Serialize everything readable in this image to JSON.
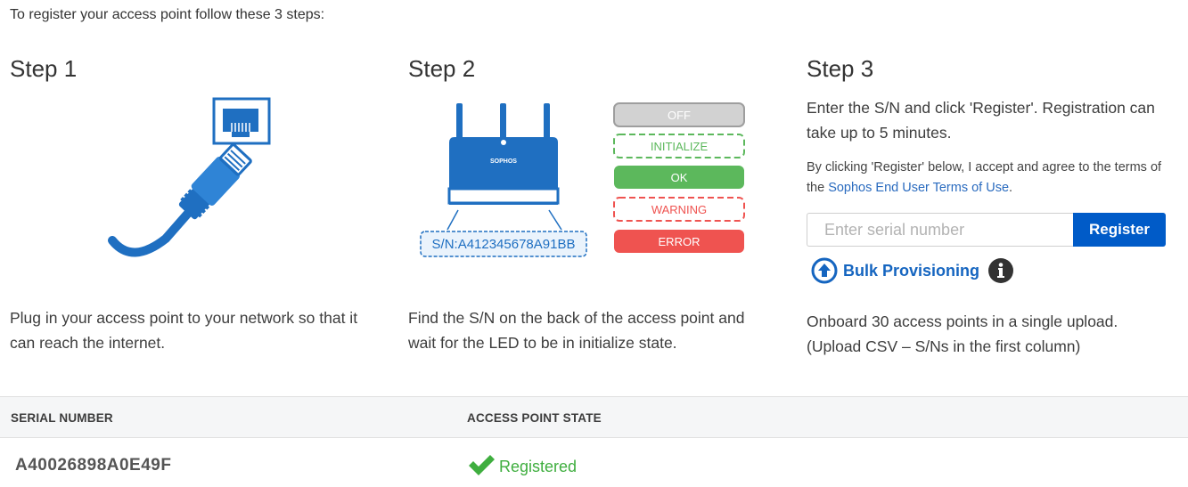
{
  "intro": "To register your access point follow these 3 steps:",
  "step1": {
    "title": "Step 1",
    "description": "Plug in your access point to your network so that it can reach the internet."
  },
  "step2": {
    "title": "Step 2",
    "description": "Find the S/N on the back of the access point and wait for the LED to be in initialize state.",
    "device_brand": "SOPHOS",
    "serial_label": "S/N:A412345678A91BB",
    "led_states": [
      "OFF",
      "INITIALIZE",
      "OK",
      "WARNING",
      "ERROR"
    ]
  },
  "step3": {
    "title": "Step 3",
    "instructions": "Enter the S/N and click 'Register'. Registration can take up to 5 minutes.",
    "terms_prefix": "By clicking 'Register' below, I accept and agree to the terms of the ",
    "terms_link": "Sophos End User Terms of Use",
    "terms_suffix": ".",
    "serial_placeholder": "Enter serial number",
    "serial_value": "",
    "register_label": "Register",
    "bulk_label": "Bulk Provisioning",
    "onboard_text": "Onboard 30 access points in a single upload. (Upload CSV – S/Ns in the first column)"
  },
  "table": {
    "headers": [
      "SERIAL NUMBER",
      "ACCESS POINT STATE"
    ],
    "rows": [
      {
        "serial": "A40026898A0E49F",
        "state": "Registered"
      }
    ]
  },
  "colors": {
    "primary": "#005bc8",
    "link": "#1565c0",
    "success": "#3fae3f",
    "device_blue": "#1f6fc1",
    "led_ok": "#5cb85c",
    "led_error": "#ef5350"
  }
}
